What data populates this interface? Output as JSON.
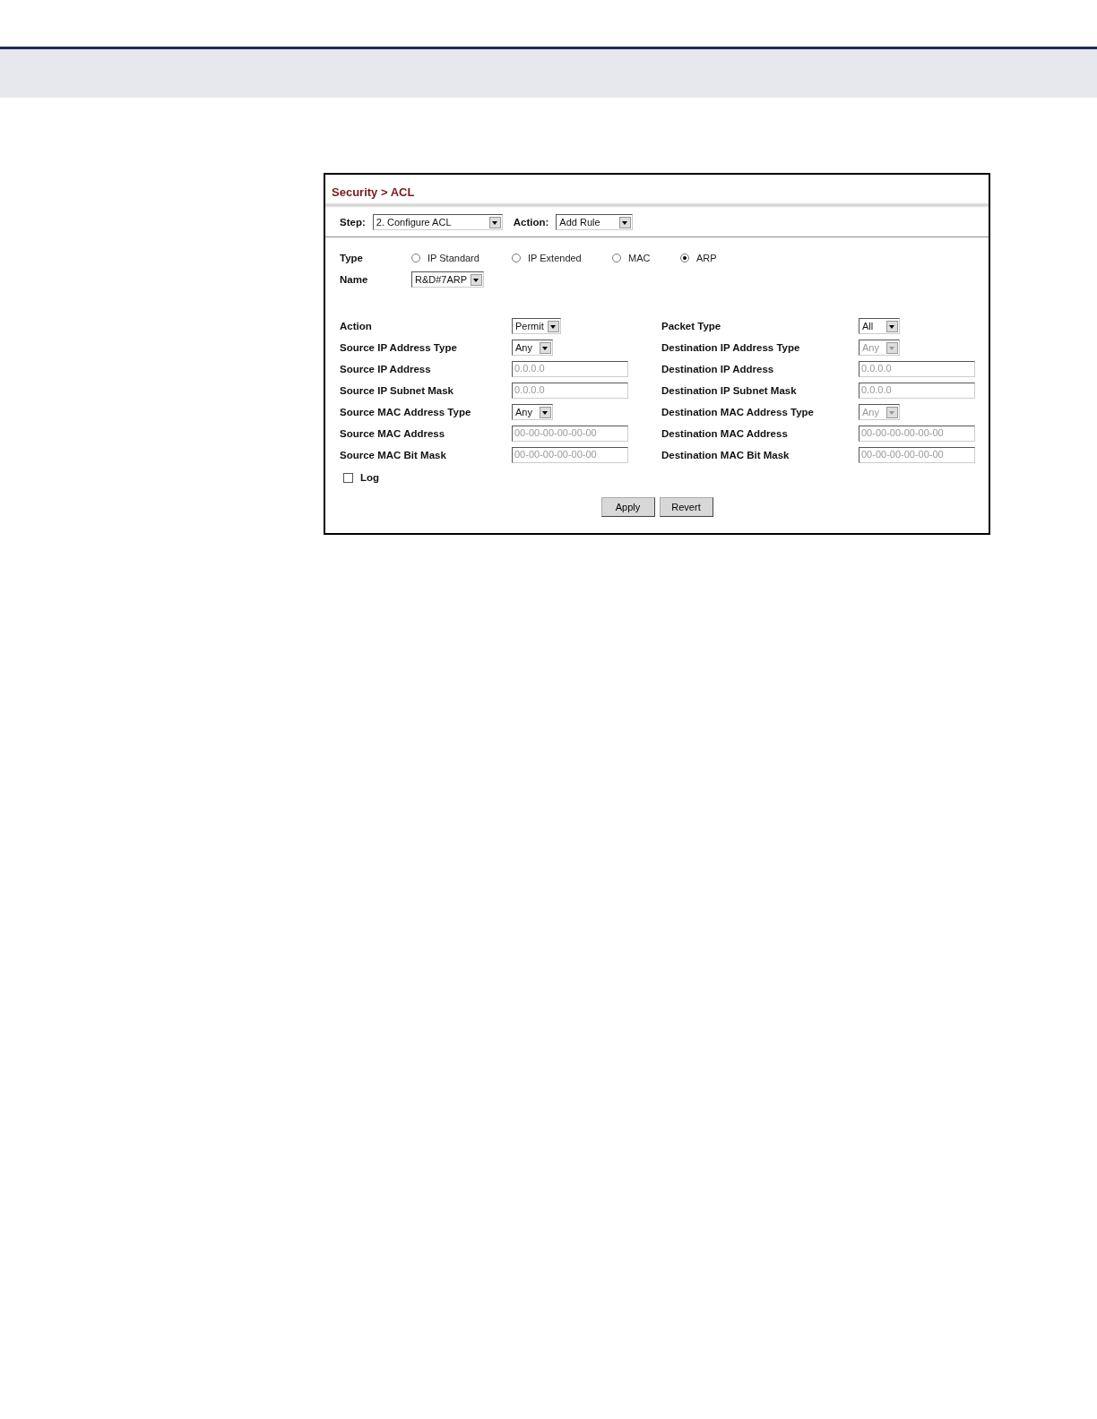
{
  "panel": {
    "breadcrumb": "Security > ACL",
    "step": {
      "label": "Step:",
      "value": "2. Configure ACL"
    },
    "action": {
      "label": "Action:",
      "value": "Add Rule"
    },
    "type": {
      "label": "Type",
      "options": [
        {
          "label": "IP Standard",
          "selected": false
        },
        {
          "label": "IP Extended",
          "selected": false
        },
        {
          "label": "MAC",
          "selected": false
        },
        {
          "label": "ARP",
          "selected": true
        }
      ]
    },
    "name": {
      "label": "Name",
      "value": "R&D#7ARP"
    },
    "left_fields": [
      {
        "label": "Action",
        "kind": "select",
        "value": "Permit",
        "disabled": false
      },
      {
        "label": "Source IP Address Type",
        "kind": "select",
        "value": "Any",
        "disabled": false
      },
      {
        "label": "Source IP Address",
        "kind": "input",
        "value": "0.0.0.0",
        "disabled": true
      },
      {
        "label": "Source IP Subnet Mask",
        "kind": "input",
        "value": "0.0.0.0",
        "disabled": true
      },
      {
        "label": "Source MAC Address Type",
        "kind": "select",
        "value": "Any",
        "disabled": false
      },
      {
        "label": "Source MAC Address",
        "kind": "input",
        "value": "00-00-00-00-00-00",
        "disabled": true
      },
      {
        "label": "Source MAC Bit Mask",
        "kind": "input",
        "value": "00-00-00-00-00-00",
        "disabled": true
      }
    ],
    "right_fields": [
      {
        "label": "Packet Type",
        "kind": "select",
        "value": "All",
        "disabled": false
      },
      {
        "label": "Destination IP Address Type",
        "kind": "select",
        "value": "Any",
        "disabled": true
      },
      {
        "label": "Destination IP Address",
        "kind": "input",
        "value": "0.0.0.0",
        "disabled": true
      },
      {
        "label": "Destination IP Subnet Mask",
        "kind": "input",
        "value": "0.0.0.0",
        "disabled": true
      },
      {
        "label": "Destination MAC Address Type",
        "kind": "select",
        "value": "Any",
        "disabled": true
      },
      {
        "label": "Destination MAC Address",
        "kind": "input",
        "value": "00-00-00-00-00-00",
        "disabled": true
      },
      {
        "label": "Destination MAC Bit Mask",
        "kind": "input",
        "value": "00-00-00-00-00-00",
        "disabled": true
      }
    ],
    "log": {
      "label": "Log",
      "checked": false
    },
    "buttons": [
      "Apply",
      "Revert"
    ]
  }
}
